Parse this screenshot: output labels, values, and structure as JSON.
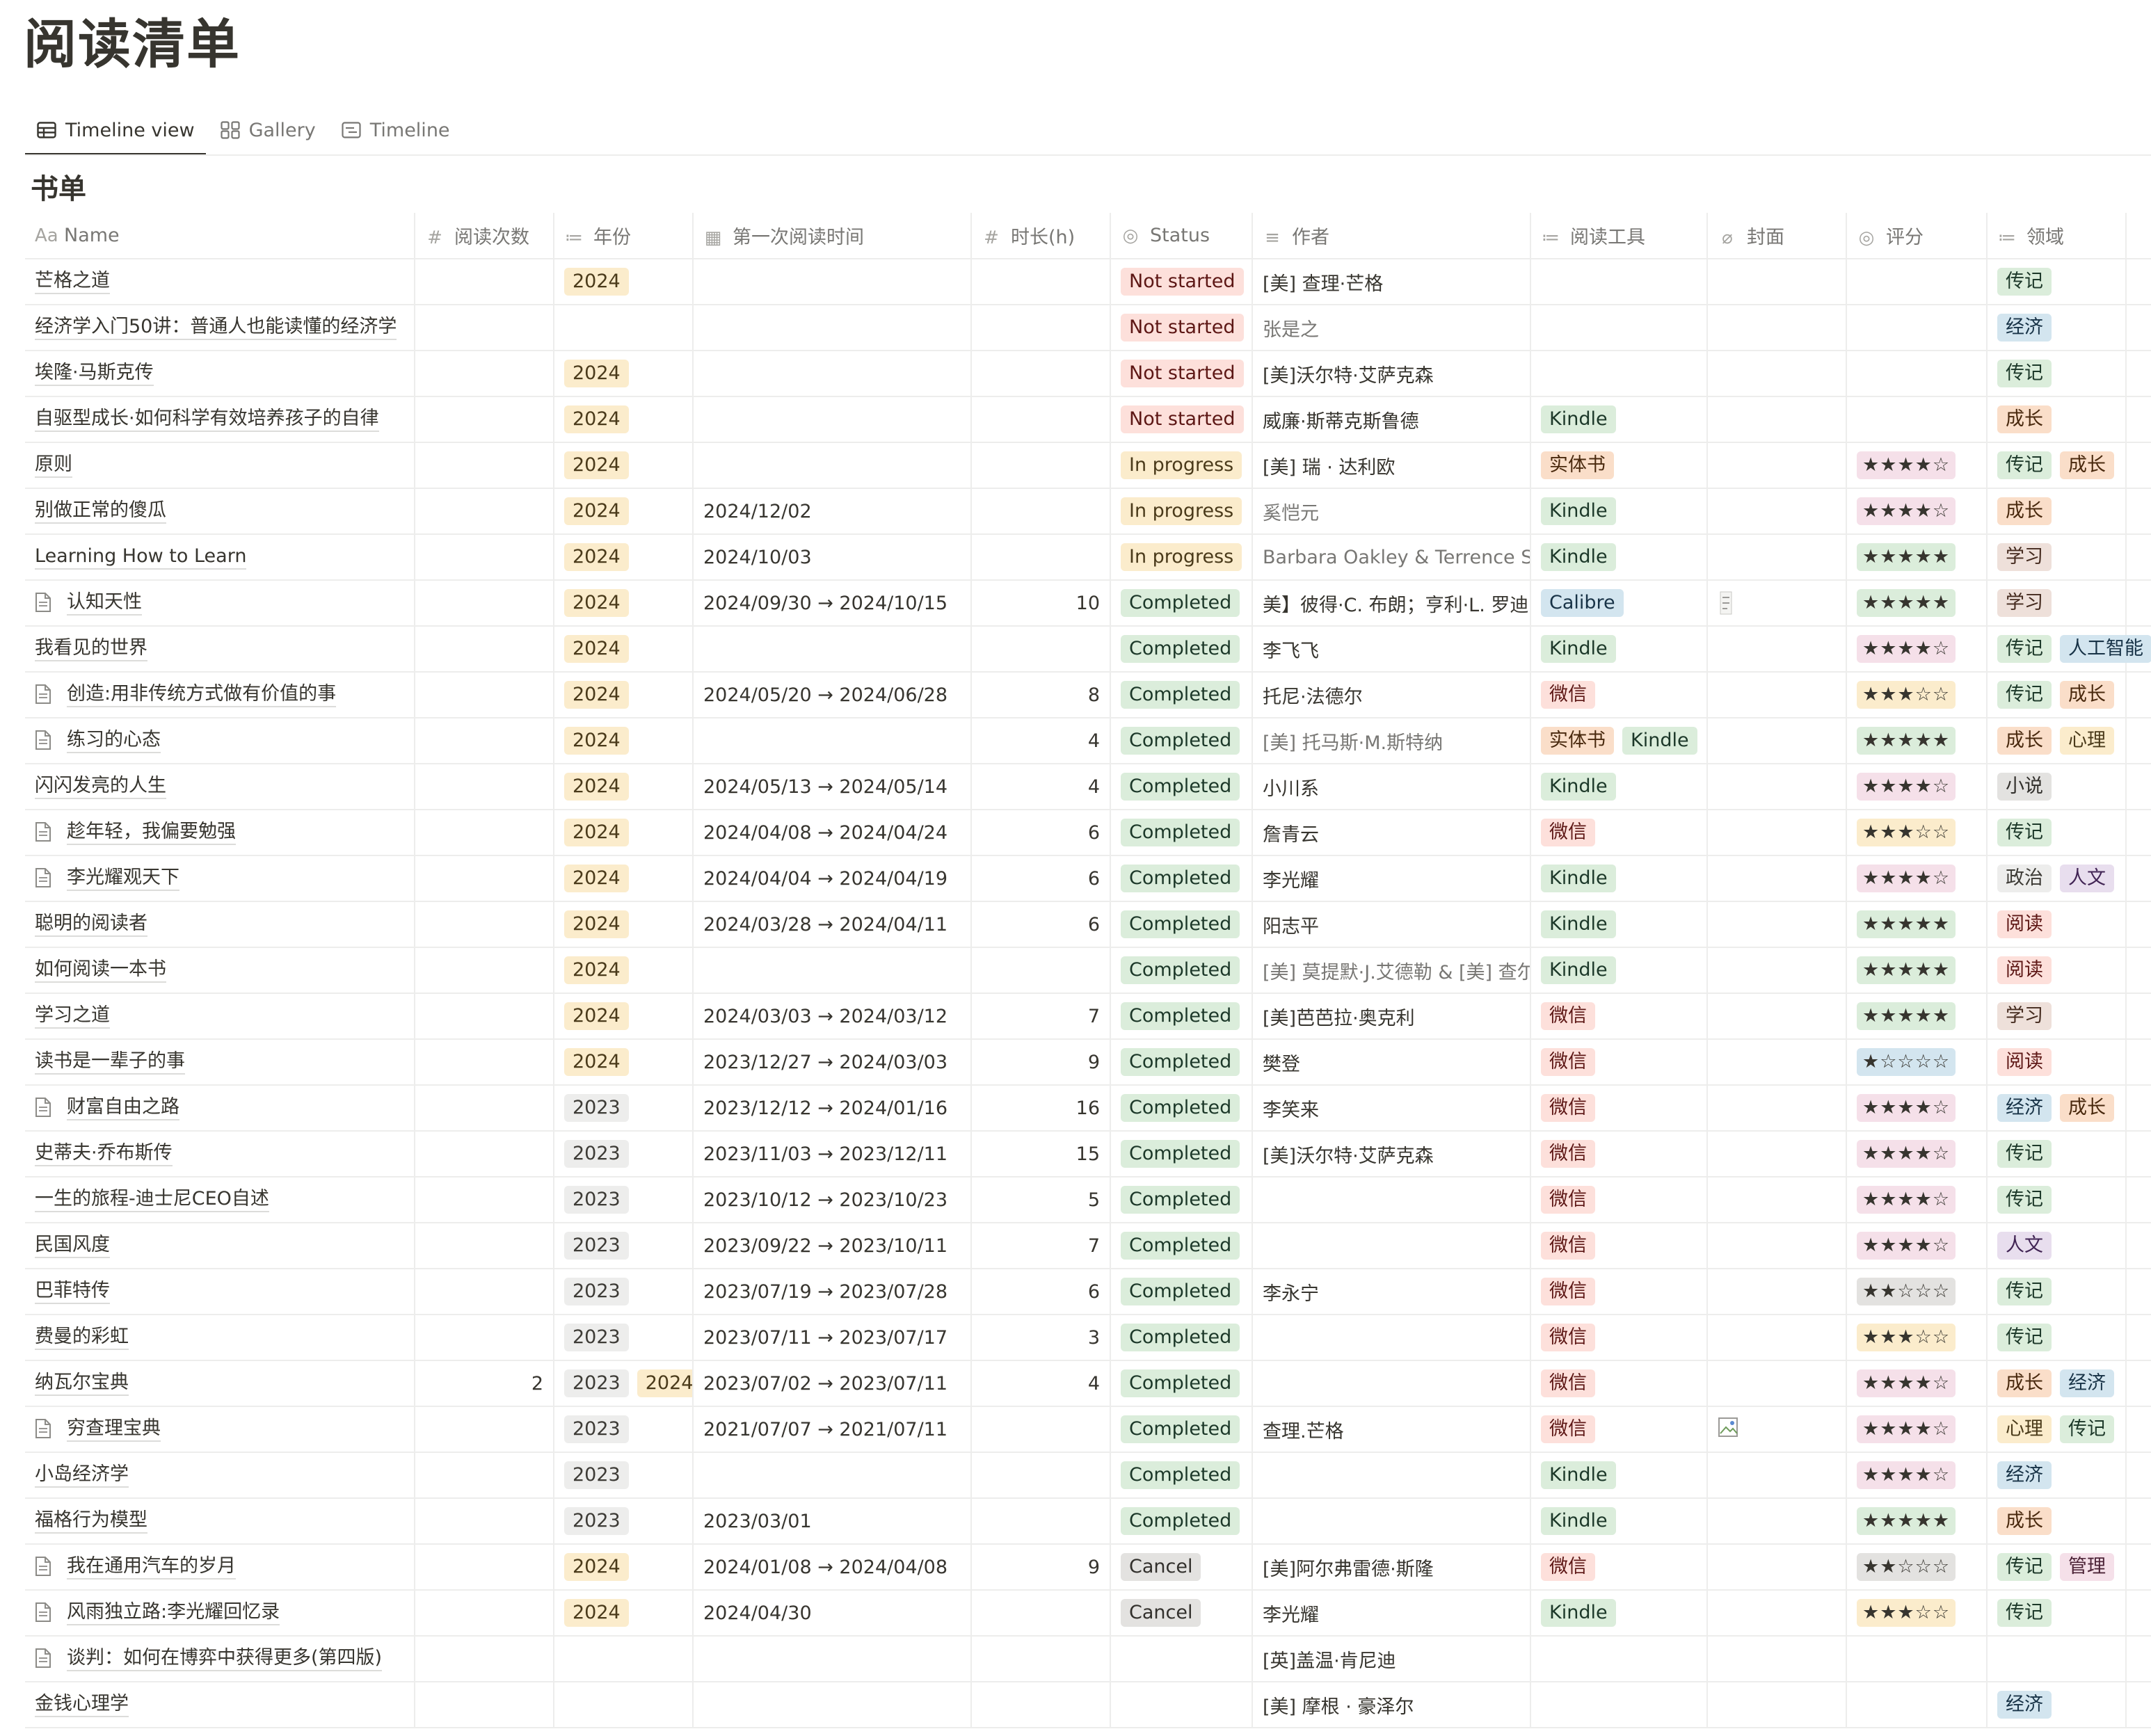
{
  "page": {
    "title": "阅读清单"
  },
  "views": [
    {
      "label": "Timeline view",
      "icon": "table-icon"
    },
    {
      "label": "Gallery",
      "icon": "gallery-icon"
    },
    {
      "label": "Timeline",
      "icon": "timeline-icon"
    }
  ],
  "database": {
    "title": "书单"
  },
  "columns": [
    {
      "label": "Name",
      "icon": "Aa"
    },
    {
      "label": "阅读次数",
      "icon": "#"
    },
    {
      "label": "年份",
      "icon": "≔"
    },
    {
      "label": "第一次阅读时间",
      "icon": "▦"
    },
    {
      "label": "时长(h)",
      "icon": "#"
    },
    {
      "label": "Status",
      "icon": "◎"
    },
    {
      "label": "作者",
      "icon": "≡"
    },
    {
      "label": "阅读工具",
      "icon": "≔"
    },
    {
      "label": "封面",
      "icon": "⌀"
    },
    {
      "label": "评分",
      "icon": "◎"
    },
    {
      "label": "领域",
      "icon": "≔"
    }
  ],
  "colors": {
    "2024": "yellow",
    "2023": "gray",
    "Kindle": "green",
    "微信": "red",
    "实体书": "orange",
    "Calibre": "blue",
    "传记": "green",
    "经济": "blue",
    "成长": "orange",
    "学习": "brown",
    "人工智能": "blue",
    "心理": "yellow",
    "小说": "default",
    "政治": "gray",
    "人文": "purple",
    "阅读": "red",
    "管理": "pink"
  },
  "rows": [
    {
      "name": "芒格之道",
      "doc": false,
      "count": "",
      "years": [
        "2024"
      ],
      "date": "",
      "hours": "",
      "status": "Not started",
      "author": "[美] 查理·芒格",
      "authorLink": false,
      "tools": [],
      "cover": "",
      "rating": "",
      "ratingColor": "",
      "fields": [
        "传记"
      ]
    },
    {
      "name": "经济学入门50讲：普通人也能读懂的经济学",
      "doc": false,
      "count": "",
      "years": [],
      "date": "",
      "hours": "",
      "status": "Not started",
      "author": "张是之",
      "authorLink": true,
      "tools": [],
      "cover": "",
      "rating": "",
      "ratingColor": "",
      "fields": [
        "经济"
      ]
    },
    {
      "name": "埃隆·马斯克传",
      "doc": false,
      "count": "",
      "years": [
        "2024"
      ],
      "date": "",
      "hours": "",
      "status": "Not started",
      "author": "[美]沃尔特·艾萨克森",
      "authorLink": false,
      "tools": [],
      "cover": "",
      "rating": "",
      "ratingColor": "",
      "fields": [
        "传记"
      ]
    },
    {
      "name": "自驱型成长·如何科学有效培养孩子的自律",
      "doc": false,
      "count": "",
      "years": [
        "2024"
      ],
      "date": "",
      "hours": "",
      "status": "Not started",
      "author": "威廉·斯蒂克斯鲁德",
      "authorLink": false,
      "tools": [
        "Kindle"
      ],
      "cover": "",
      "rating": "",
      "ratingColor": "",
      "fields": [
        "成长"
      ]
    },
    {
      "name": "原则",
      "doc": false,
      "count": "",
      "years": [
        "2024"
      ],
      "date": "",
      "hours": "",
      "status": "In progress",
      "author": "[美] 瑞 · 达利欧",
      "authorLink": false,
      "tools": [
        "实体书"
      ],
      "cover": "",
      "rating": "★★★★☆",
      "ratingColor": "pink",
      "fields": [
        "传记",
        "成长"
      ]
    },
    {
      "name": "别做正常的傻瓜",
      "doc": false,
      "count": "",
      "years": [
        "2024"
      ],
      "date": "2024/12/02",
      "hours": "",
      "status": "In progress",
      "author": "奚恺元",
      "authorLink": true,
      "tools": [
        "Kindle"
      ],
      "cover": "",
      "rating": "★★★★☆",
      "ratingColor": "pink",
      "fields": [
        "成长"
      ]
    },
    {
      "name": "Learning How to Learn",
      "doc": false,
      "count": "",
      "years": [
        "2024"
      ],
      "date": "2024/10/03",
      "hours": "",
      "status": "In progress",
      "author": "Barbara Oakley & Terrence Se",
      "authorLink": true,
      "tools": [
        "Kindle"
      ],
      "cover": "",
      "rating": "★★★★★",
      "ratingColor": "green",
      "fields": [
        "学习"
      ]
    },
    {
      "name": "认知天性",
      "doc": true,
      "count": "",
      "years": [
        "2024"
      ],
      "date": "2024/09/30 → 2024/10/15",
      "hours": "10",
      "status": "Completed",
      "author": "美】彼得·C. 布朗；亨利·L. 罗迪",
      "authorLink": false,
      "tools": [
        "Calibre"
      ],
      "cover": "img",
      "rating": "★★★★★",
      "ratingColor": "green",
      "fields": [
        "学习"
      ]
    },
    {
      "name": "我看见的世界",
      "doc": false,
      "count": "",
      "years": [
        "2024"
      ],
      "date": "",
      "hours": "",
      "status": "Completed",
      "author": "李飞飞",
      "authorLink": false,
      "tools": [
        "Kindle"
      ],
      "cover": "",
      "rating": "★★★★☆",
      "ratingColor": "pink",
      "fields": [
        "传记",
        "人工智能"
      ]
    },
    {
      "name": "创造:用非传统方式做有价值的事",
      "doc": true,
      "count": "",
      "years": [
        "2024"
      ],
      "date": "2024/05/20 → 2024/06/28",
      "hours": "8",
      "status": "Completed",
      "author": "托尼·法德尔",
      "authorLink": false,
      "tools": [
        "微信"
      ],
      "cover": "",
      "rating": "★★★☆☆",
      "ratingColor": "yellow",
      "fields": [
        "传记",
        "成长"
      ]
    },
    {
      "name": "练习的心态",
      "doc": true,
      "count": "",
      "years": [
        "2024"
      ],
      "date": "",
      "hours": "4",
      "status": "Completed",
      "author": "[美] 托马斯·M.斯特纳",
      "authorLink": true,
      "tools": [
        "实体书",
        "Kindle"
      ],
      "cover": "",
      "rating": "★★★★★",
      "ratingColor": "green",
      "fields": [
        "成长",
        "心理"
      ]
    },
    {
      "name": "闪闪发亮的人生",
      "doc": false,
      "count": "",
      "years": [
        "2024"
      ],
      "date": "2024/05/13 → 2024/05/14",
      "hours": "4",
      "status": "Completed",
      "author": "小川系",
      "authorLink": false,
      "tools": [
        "Kindle"
      ],
      "cover": "",
      "rating": "★★★★☆",
      "ratingColor": "pink",
      "fields": [
        "小说"
      ]
    },
    {
      "name": "趁年轻，我偏要勉强",
      "doc": true,
      "count": "",
      "years": [
        "2024"
      ],
      "date": "2024/04/08 → 2024/04/24",
      "hours": "6",
      "status": "Completed",
      "author": "詹青云",
      "authorLink": false,
      "tools": [
        "微信"
      ],
      "cover": "",
      "rating": "★★★☆☆",
      "ratingColor": "yellow",
      "fields": [
        "传记"
      ]
    },
    {
      "name": "李光耀观天下",
      "doc": true,
      "count": "",
      "years": [
        "2024"
      ],
      "date": "2024/04/04 → 2024/04/19",
      "hours": "6",
      "status": "Completed",
      "author": "李光耀",
      "authorLink": false,
      "tools": [
        "Kindle"
      ],
      "cover": "",
      "rating": "★★★★☆",
      "ratingColor": "pink",
      "fields": [
        "政治",
        "人文"
      ]
    },
    {
      "name": "聪明的阅读者",
      "doc": false,
      "count": "",
      "years": [
        "2024"
      ],
      "date": "2024/03/28 → 2024/04/11",
      "hours": "6",
      "status": "Completed",
      "author": "阳志平",
      "authorLink": false,
      "tools": [
        "Kindle"
      ],
      "cover": "",
      "rating": "★★★★★",
      "ratingColor": "green",
      "fields": [
        "阅读"
      ]
    },
    {
      "name": "如何阅读一本书",
      "doc": false,
      "count": "",
      "years": [
        "2024"
      ],
      "date": "",
      "hours": "",
      "status": "Completed",
      "author": "[美] 莫提默·J.艾德勒 & [美] 查尔",
      "authorLink": true,
      "tools": [
        "Kindle"
      ],
      "cover": "",
      "rating": "★★★★★",
      "ratingColor": "green",
      "fields": [
        "阅读"
      ]
    },
    {
      "name": "学习之道",
      "doc": false,
      "count": "",
      "years": [
        "2024"
      ],
      "date": "2024/03/03 → 2024/03/12",
      "hours": "7",
      "status": "Completed",
      "author": "[美]芭芭拉·奥克利",
      "authorLink": false,
      "tools": [
        "微信"
      ],
      "cover": "",
      "rating": "★★★★★",
      "ratingColor": "green",
      "fields": [
        "学习"
      ]
    },
    {
      "name": "读书是一辈子的事",
      "doc": false,
      "count": "",
      "years": [
        "2024"
      ],
      "date": "2023/12/27 → 2024/03/03",
      "hours": "9",
      "status": "Completed",
      "author": "樊登",
      "authorLink": false,
      "tools": [
        "微信"
      ],
      "cover": "",
      "rating": "★☆☆☆☆",
      "ratingColor": "blue",
      "fields": [
        "阅读"
      ]
    },
    {
      "name": "财富自由之路",
      "doc": true,
      "count": "",
      "years": [
        "2023"
      ],
      "date": "2023/12/12 → 2024/01/16",
      "hours": "16",
      "status": "Completed",
      "author": "李笑来",
      "authorLink": false,
      "tools": [
        "微信"
      ],
      "cover": "",
      "rating": "★★★★☆",
      "ratingColor": "pink",
      "fields": [
        "经济",
        "成长"
      ]
    },
    {
      "name": "史蒂夫·乔布斯传",
      "doc": false,
      "count": "",
      "years": [
        "2023"
      ],
      "date": "2023/11/03 → 2023/12/11",
      "hours": "15",
      "status": "Completed",
      "author": "[美]沃尔特·艾萨克森",
      "authorLink": false,
      "tools": [
        "微信"
      ],
      "cover": "",
      "rating": "★★★★☆",
      "ratingColor": "pink",
      "fields": [
        "传记"
      ]
    },
    {
      "name": "一生的旅程-迪士尼CEO自述",
      "doc": false,
      "count": "",
      "years": [
        "2023"
      ],
      "date": "2023/10/12 → 2023/10/23",
      "hours": "5",
      "status": "Completed",
      "author": "",
      "authorLink": false,
      "tools": [
        "微信"
      ],
      "cover": "",
      "rating": "★★★★☆",
      "ratingColor": "pink",
      "fields": [
        "传记"
      ]
    },
    {
      "name": "民国风度",
      "doc": false,
      "count": "",
      "years": [
        "2023"
      ],
      "date": "2023/09/22 → 2023/10/11",
      "hours": "7",
      "status": "Completed",
      "author": "",
      "authorLink": false,
      "tools": [
        "微信"
      ],
      "cover": "",
      "rating": "★★★★☆",
      "ratingColor": "pink",
      "fields": [
        "人文"
      ]
    },
    {
      "name": "巴菲特传",
      "doc": false,
      "count": "",
      "years": [
        "2023"
      ],
      "date": "2023/07/19 → 2023/07/28",
      "hours": "6",
      "status": "Completed",
      "author": "李永宁",
      "authorLink": false,
      "tools": [
        "微信"
      ],
      "cover": "",
      "rating": "★★☆☆☆",
      "ratingColor": "gray",
      "fields": [
        "传记"
      ]
    },
    {
      "name": "费曼的彩虹",
      "doc": false,
      "count": "",
      "years": [
        "2023"
      ],
      "date": "2023/07/11 → 2023/07/17",
      "hours": "3",
      "status": "Completed",
      "author": "",
      "authorLink": false,
      "tools": [
        "微信"
      ],
      "cover": "",
      "rating": "★★★☆☆",
      "ratingColor": "yellow",
      "fields": [
        "传记"
      ]
    },
    {
      "name": "纳瓦尔宝典",
      "doc": false,
      "count": "2",
      "years": [
        "2023",
        "2024"
      ],
      "date": "2023/07/02 → 2023/07/11",
      "hours": "4",
      "status": "Completed",
      "author": "",
      "authorLink": false,
      "tools": [
        "微信"
      ],
      "cover": "",
      "rating": "★★★★☆",
      "ratingColor": "pink",
      "fields": [
        "成长",
        "经济"
      ]
    },
    {
      "name": "穷查理宝典",
      "doc": true,
      "count": "",
      "years": [
        "2023"
      ],
      "date": "2021/07/07 → 2021/07/11",
      "hours": "",
      "status": "Completed",
      "author": "查理.芒格",
      "authorLink": false,
      "tools": [
        "微信"
      ],
      "cover": "broken",
      "rating": "★★★★☆",
      "ratingColor": "pink",
      "fields": [
        "心理",
        "传记"
      ]
    },
    {
      "name": "小岛经济学",
      "doc": false,
      "count": "",
      "years": [
        "2023"
      ],
      "date": "",
      "hours": "",
      "status": "Completed",
      "author": "",
      "authorLink": false,
      "tools": [
        "Kindle"
      ],
      "cover": "",
      "rating": "★★★★☆",
      "ratingColor": "pink",
      "fields": [
        "经济"
      ]
    },
    {
      "name": "福格行为模型",
      "doc": false,
      "count": "",
      "years": [
        "2023"
      ],
      "date": "2023/03/01",
      "hours": "",
      "status": "Completed",
      "author": "",
      "authorLink": false,
      "tools": [
        "Kindle"
      ],
      "cover": "",
      "rating": "★★★★★",
      "ratingColor": "green",
      "fields": [
        "成长"
      ]
    },
    {
      "name": "我在通用汽车的岁月",
      "doc": true,
      "count": "",
      "years": [
        "2024"
      ],
      "date": "2024/01/08 → 2024/04/08",
      "hours": "9",
      "status": "Cancel",
      "author": "[美]阿尔弗雷德·斯隆",
      "authorLink": false,
      "tools": [
        "微信"
      ],
      "cover": "",
      "rating": "★★☆☆☆",
      "ratingColor": "gray",
      "fields": [
        "传记",
        "管理"
      ]
    },
    {
      "name": "风雨独立路:李光耀回忆录",
      "doc": true,
      "count": "",
      "years": [
        "2024"
      ],
      "date": "2024/04/30",
      "hours": "",
      "status": "Cancel",
      "author": "李光耀",
      "authorLink": false,
      "tools": [
        "Kindle"
      ],
      "cover": "",
      "rating": "★★★☆☆",
      "ratingColor": "yellow",
      "fields": [
        "传记"
      ]
    },
    {
      "name": "谈判：如何在博弈中获得更多(第四版)",
      "doc": true,
      "count": "",
      "years": [],
      "date": "",
      "hours": "",
      "status": "",
      "author": "[英]盖温·肯尼迪",
      "authorLink": false,
      "tools": [],
      "cover": "",
      "rating": "",
      "ratingColor": "",
      "fields": []
    },
    {
      "name": "金钱心理学",
      "doc": false,
      "count": "",
      "years": [],
      "date": "",
      "hours": "",
      "status": "",
      "author": "[美] 摩根 · 豪泽尔",
      "authorLink": false,
      "tools": [],
      "cover": "",
      "rating": "",
      "ratingColor": "",
      "fields": [
        "经济"
      ]
    }
  ]
}
